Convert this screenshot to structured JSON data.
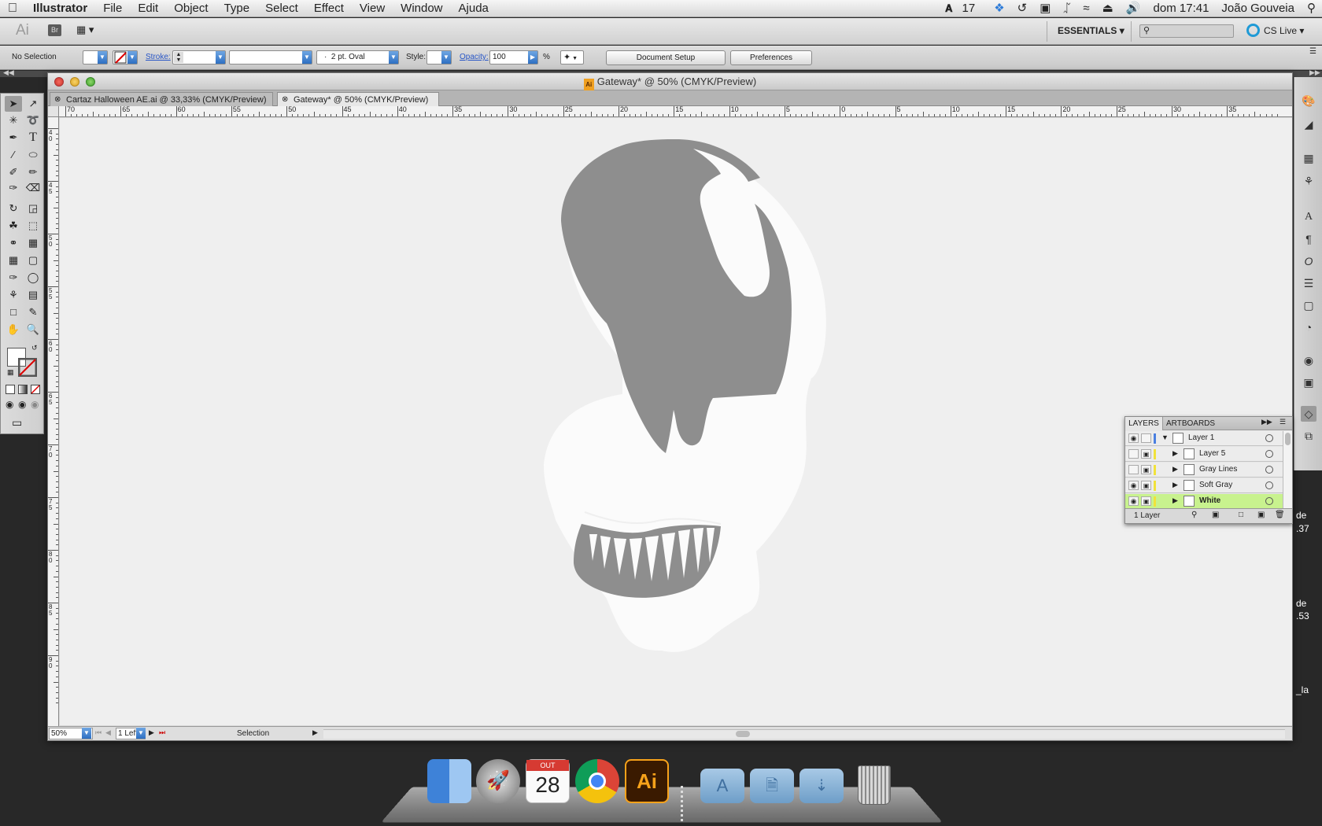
{
  "menubar": {
    "app_name": "Illustrator",
    "items": [
      "File",
      "Edit",
      "Object",
      "Type",
      "Select",
      "Effect",
      "View",
      "Window",
      "Ajuda"
    ],
    "status": {
      "adobe_updates": "17",
      "clock": "dom 17:41",
      "user": "João Gouveia"
    }
  },
  "appbar": {
    "logo": "Ai",
    "bridge": "Br",
    "workspace": "ESSENTIALS",
    "search_placeholder": "",
    "cs_live": "CS Live"
  },
  "control": {
    "selection": "No Selection",
    "stroke_label": "Stroke:",
    "brush": "2 pt. Oval",
    "brush_prefix": "·",
    "style_label": "Style:",
    "opacity_label": "Opacity:",
    "opacity_value": "100",
    "opacity_unit": "%",
    "document_setup": "Document Setup",
    "preferences": "Preferences"
  },
  "document": {
    "window_title": "Gateway* @ 50% (CMYK/Preview)",
    "tabs": [
      {
        "label": "Cartaz Halloween AE.ai @ 33,33% (CMYK/Preview)",
        "active": false
      },
      {
        "label": "Gateway* @ 50% (CMYK/Preview)",
        "active": true
      }
    ],
    "hruler_ticks": [
      "70",
      "65",
      "60",
      "55",
      "50",
      "45",
      "40",
      "35",
      "30",
      "25",
      "20",
      "15",
      "10",
      "5",
      "0",
      "5",
      "10",
      "15",
      "20",
      "25",
      "30",
      "35"
    ],
    "vruler_ticks": [
      "4\n0",
      "4\n5",
      "5\n0",
      "5\n5",
      "6\n0",
      "6\n5",
      "7\n0",
      "7\n5",
      "8\n0",
      "8\n5",
      "9\n0"
    ],
    "status": {
      "zoom": "50%",
      "artboard": "1",
      "artboard_label": "Left",
      "tool": "Selection"
    }
  },
  "layers_panel": {
    "tab_layers": "LAYERS",
    "tab_artboards": "ARTBOARDS",
    "rows": [
      {
        "name": "Layer 1",
        "level": 0,
        "visible": true,
        "selected": false
      },
      {
        "name": "Layer 5",
        "level": 1,
        "visible": false,
        "selected": false
      },
      {
        "name": "Gray Lines",
        "level": 1,
        "visible": false,
        "selected": false
      },
      {
        "name": "Soft Gray",
        "level": 1,
        "visible": true,
        "selected": false
      },
      {
        "name": "White",
        "level": 1,
        "visible": true,
        "selected": true
      }
    ],
    "footer": "1 Layer"
  },
  "desktop_partial_labels": [
    "de",
    ".37",
    "de",
    ".53",
    "_la"
  ],
  "dock": {
    "calendar_month": "OUT",
    "calendar_day": "28",
    "illustrator_label": "Ai"
  },
  "colors": {
    "artwork_gray": "#8e8e8e",
    "artwork_white": "#fbfbfb",
    "canvas": "#efefef",
    "layer_selected": "#c8f28e",
    "link_blue": "#2856c7"
  }
}
